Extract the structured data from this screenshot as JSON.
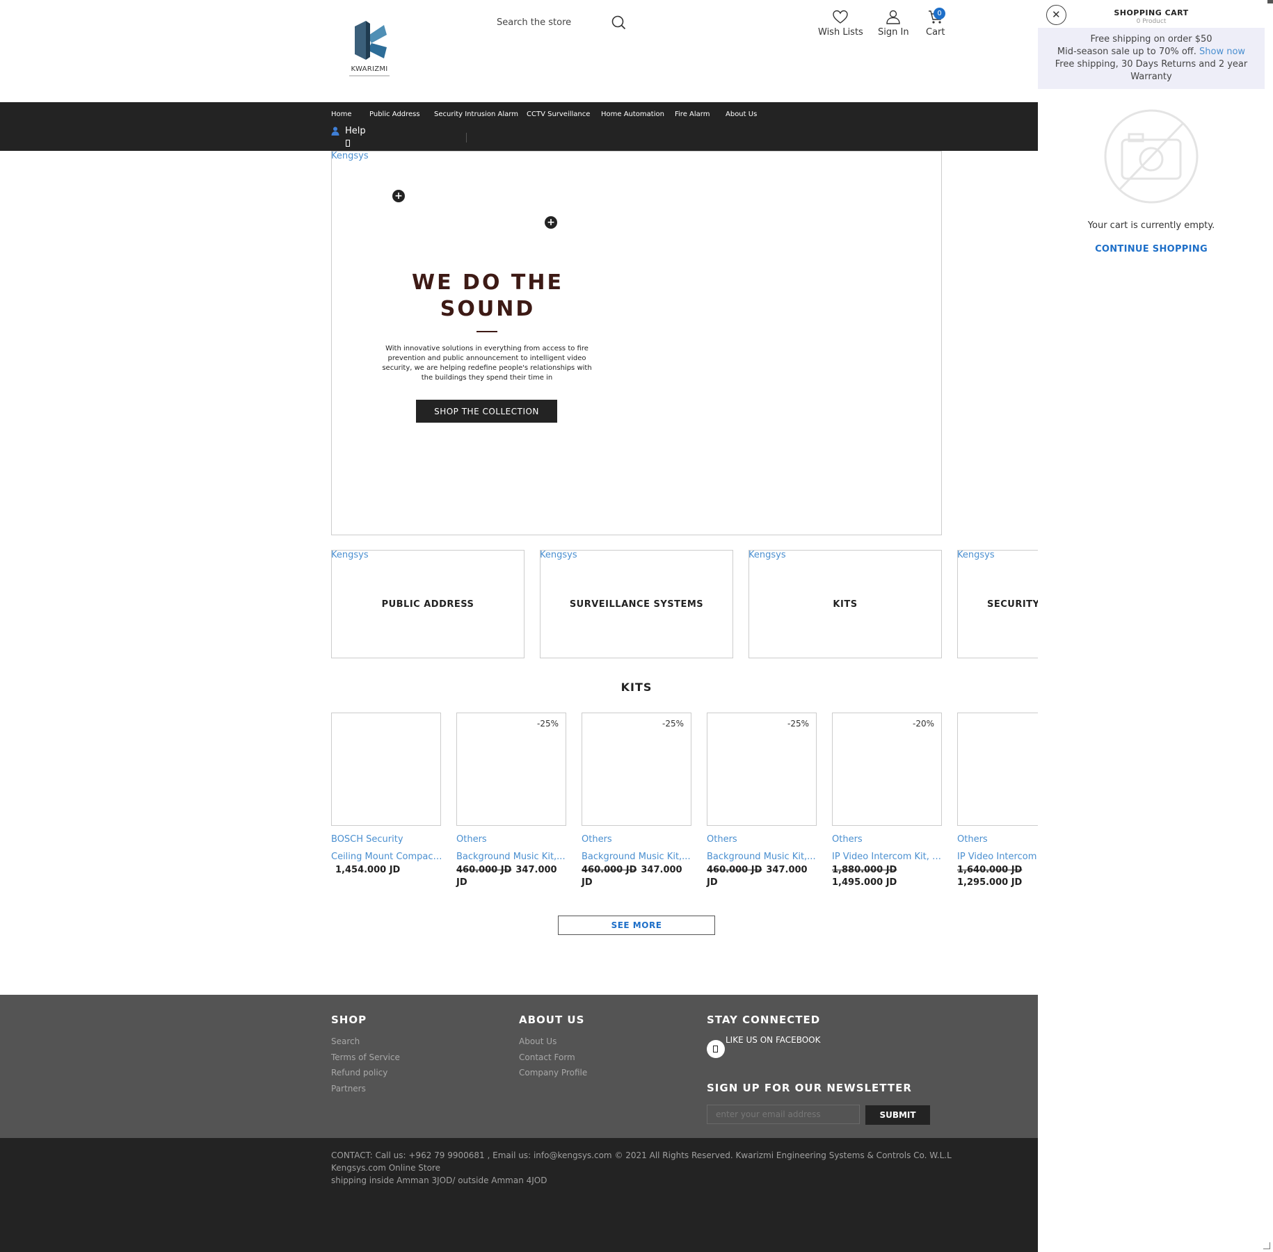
{
  "header": {
    "logo_text": "KWARIZMI",
    "search_placeholder": "Search the store",
    "wishlist_label": "Wish Lists",
    "signin_label": "Sign In",
    "cart_label": "Cart",
    "cart_count": "0"
  },
  "nav": {
    "items": [
      "Home",
      "Public Address",
      "Security Intrusion Alarm",
      "CCTV Surveillance",
      "Home Automation",
      "Fire Alarm",
      "About Us"
    ],
    "help_label": "Help"
  },
  "hero": {
    "link_text": "Kengsys",
    "title_line1": "WE DO THE",
    "title_line2": "SOUND",
    "text": "With innovative solutions in everything from access to fire prevention and public announcement to intelligent video security, we are helping redefine people's relationships with the buildings they spend their time in",
    "button_label": "SHOP THE COLLECTION"
  },
  "categories": [
    {
      "link": "Kengsys",
      "label": "PUBLIC ADDRESS"
    },
    {
      "link": "Kengsys",
      "label": "SURVEILLANCE SYSTEMS"
    },
    {
      "link": "Kengsys",
      "label": "KITS"
    },
    {
      "link": "Kengsys",
      "label": "SECURITY I"
    }
  ],
  "kits": {
    "title": "KITS",
    "products": [
      {
        "discount": "",
        "vendor": "BOSCH Security",
        "name": "Ceiling Mount Compact...",
        "old_price": "",
        "price": "1,454.000 JD"
      },
      {
        "discount": "-25%",
        "vendor": "Others",
        "name": "Background Music Kit,...",
        "old_price": "460.000 JD",
        "price": "347.000 JD"
      },
      {
        "discount": "-25%",
        "vendor": "Others",
        "name": "Background Music Kit,...",
        "old_price": "460.000 JD",
        "price": "347.000 JD"
      },
      {
        "discount": "-25%",
        "vendor": "Others",
        "name": "Background Music Kit,...",
        "old_price": "460.000 JD",
        "price": "347.000 JD"
      },
      {
        "discount": "-20%",
        "vendor": "Others",
        "name": "IP Video Intercom Kit, Ten...",
        "old_price": "1,880.000 JD",
        "price": "1,495.000 JD"
      },
      {
        "discount": "",
        "vendor": "Others",
        "name": "IP Video Intercom K",
        "old_price": "1,640.000 JD",
        "price": "1,295.000 JD"
      }
    ],
    "see_more": "SEE MORE"
  },
  "footer": {
    "shop_title": "SHOP",
    "shop_links": [
      "Search",
      "Terms of Service",
      "Refund policy",
      "Partners"
    ],
    "about_title": "ABOUT US",
    "about_links": [
      "About Us",
      "Contact Form",
      "Company Profile"
    ],
    "connected_title": "STAY CONNECTED",
    "facebook_label": "LIKE US ON FACEBOOK",
    "newsletter_title": "SIGN UP FOR OUR NEWSLETTER",
    "email_placeholder": "enter your email address",
    "submit_label": "SUBMIT"
  },
  "bottom": {
    "line1": "CONTACT: Call us: +962 79 9900681 , Email us: info@kengsys.com © 2021 All Rights Reserved. Kwarizmi Engineering Systems & Controls Co. W.L.L",
    "line2": "Kengsys.com Online Store",
    "line3": "shipping inside Amman 3JOD/ outside Amman 4JOD"
  },
  "cart_drawer": {
    "title": "SHOPPING CART",
    "subtitle": "0 Product",
    "promo_line1": "Free shipping on order $50",
    "promo_line2": "Mid-season sale up to 70% off.",
    "promo_link": "Show now",
    "promo_line3": "Free shipping, 30 Days Returns and 2 year Warranty",
    "empty_text": "Your cart is currently empty.",
    "continue_label": "CONTINUE SHOPPING"
  },
  "colors": {
    "accent_blue": "#1e6fc8",
    "link_blue": "#4a8fd0",
    "nav_bg": "#232323",
    "footer_bg": "#545454",
    "hero_title": "#3d1a15",
    "promo_bg": "#eeeef8"
  }
}
